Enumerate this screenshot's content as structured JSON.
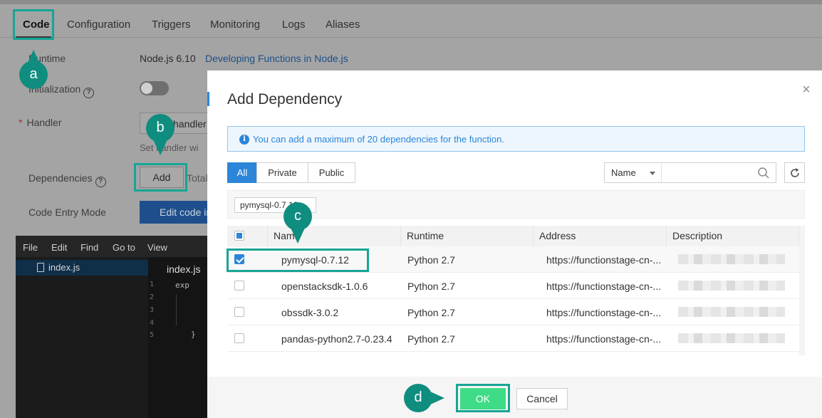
{
  "tabs": [
    "Code",
    "Configuration",
    "Triggers",
    "Monitoring",
    "Logs",
    "Aliases"
  ],
  "form": {
    "runtime_label": "Runtime",
    "runtime_value": "Node.js 6.10",
    "runtime_link": "Developing Functions in Node.js",
    "initialization_label": "Initialization",
    "handler_label": "Handler",
    "handler_required": "*",
    "handler_value": "handler",
    "handler_hint": "Set handler wi",
    "dependencies_label": "Dependencies",
    "add_button": "Add",
    "total_text": "Total",
    "code_entry_label": "Code Entry Mode",
    "edit_code_button": "Edit code in"
  },
  "editor": {
    "menu": [
      "File",
      "Edit",
      "Find",
      "Go to",
      "View"
    ],
    "file": "index.js",
    "tab": "index.js",
    "lines": [
      "1",
      "2",
      "3",
      "4",
      "5"
    ],
    "code": [
      "exp",
      "}"
    ]
  },
  "markers": {
    "a": "a",
    "b": "b",
    "c": "c",
    "d": "d"
  },
  "modal": {
    "title": "Add Dependency",
    "close": "×",
    "info_icon": "i",
    "info": "You can add a maximum of 20 dependencies for the function.",
    "filters": [
      "All",
      "Private",
      "Public"
    ],
    "search_field": "Name",
    "search_placeholder": "",
    "selected_chip": "pymysql-0.7.12",
    "columns": [
      "Name",
      "Runtime",
      "Address",
      "Description"
    ],
    "rows": [
      {
        "name": "pymysql-0.7.12",
        "runtime": "Python 2.7",
        "address": "https://functionstage-cn-...",
        "checked": true
      },
      {
        "name": "openstacksdk-1.0.6",
        "runtime": "Python 2.7",
        "address": "https://functionstage-cn-...",
        "checked": false
      },
      {
        "name": "obssdk-3.0.2",
        "runtime": "Python 2.7",
        "address": "https://functionstage-cn-...",
        "checked": false
      },
      {
        "name": "pandas-python2.7-0.23.4",
        "runtime": "Python 2.7",
        "address": "https://functionstage-cn-...",
        "checked": false
      }
    ],
    "ok": "OK",
    "cancel": "Cancel"
  },
  "colors": {
    "accent": "#2b86d9",
    "ok_green": "#3fdc87",
    "marker_teal": "#0f8d7f"
  }
}
